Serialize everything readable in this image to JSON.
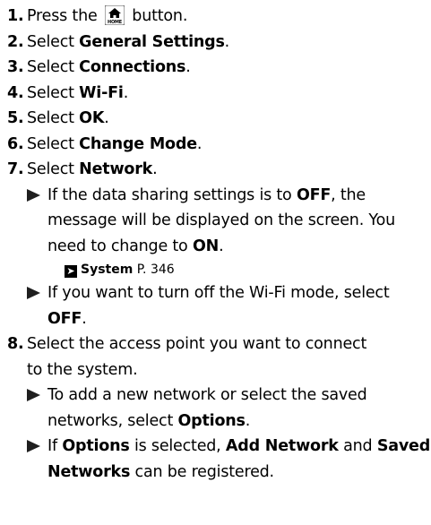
{
  "steps": [
    {
      "num": "1.",
      "pre": "Press the",
      "icon": "home-icon",
      "icon_text": "HOME",
      "post": "button."
    },
    {
      "num": "2.",
      "pre": "Select",
      "bold": "General Settings",
      "post": "."
    },
    {
      "num": "3.",
      "pre": "Select",
      "bold": "Connections",
      "post": "."
    },
    {
      "num": "4.",
      "pre": "Select",
      "bold": "Wi-Fi",
      "post": "."
    },
    {
      "num": "5.",
      "pre": "Select",
      "bold": "OK",
      "post": "."
    },
    {
      "num": "6.",
      "pre": "Select",
      "bold": "Change Mode",
      "post": "."
    },
    {
      "num": "7.",
      "pre": "Select",
      "bold": "Network",
      "post": "."
    },
    {
      "num": "8.",
      "text_line1": "Select the access point you want to connect",
      "text_line2": "to the system."
    }
  ],
  "step7_notes": {
    "note1": {
      "pre": "If the data sharing settings is to",
      "bold1": "OFF",
      "mid": ", the message will be displayed on the screen. You need to change to",
      "bold2": "ON",
      "post": "."
    },
    "reference": {
      "arrow_icon": "reference-arrow-icon",
      "label": "System",
      "page": "P. 346"
    },
    "note2": {
      "pre": "If you want to turn off the Wi-Fi mode, select",
      "bold": "OFF",
      "post": "."
    }
  },
  "step8_notes": {
    "note1": {
      "pre": "To add a new network or select the saved networks, select",
      "bold": "Options",
      "post": "."
    },
    "note2": {
      "pre": "If",
      "bold1": "Options",
      "mid": "is selected,",
      "bold2": "Add Network",
      "and": "and",
      "bold3": "Saved Networks",
      "post": "can be registered."
    }
  }
}
